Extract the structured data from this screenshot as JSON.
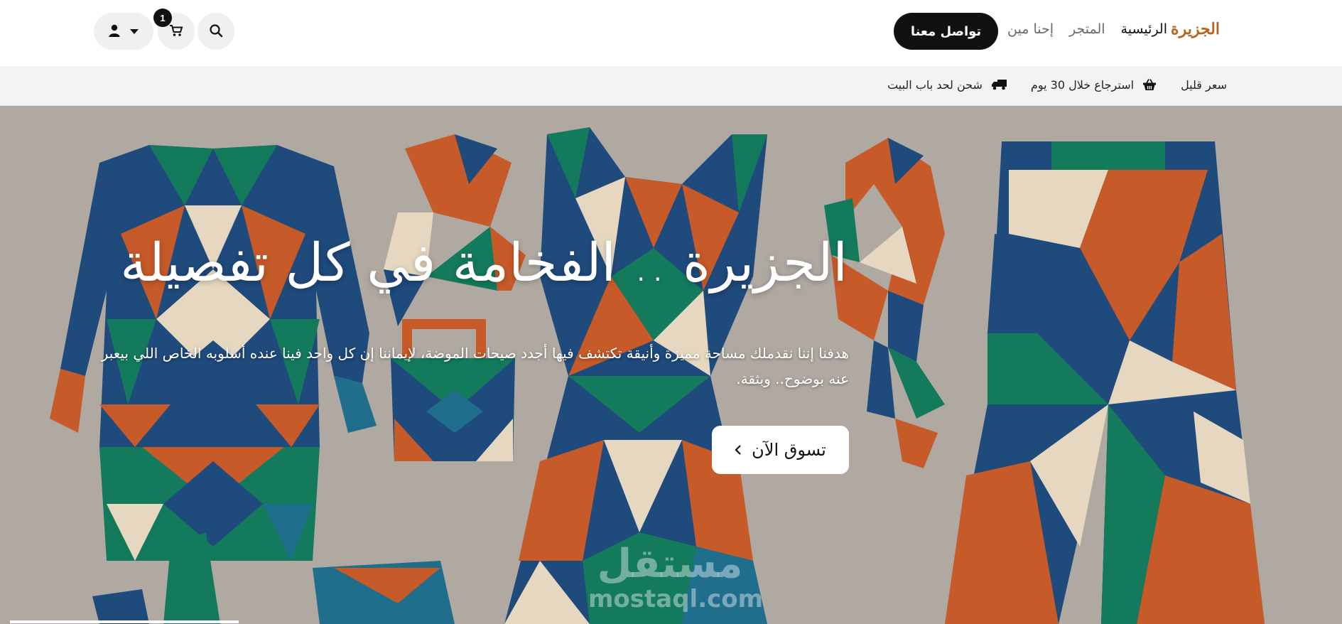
{
  "header": {
    "logo_text": "الجزيرة",
    "nav": [
      {
        "label": "الرئيسية",
        "active": true
      },
      {
        "label": "المتجر",
        "active": false
      },
      {
        "label": "إحنا مين",
        "active": false
      }
    ],
    "contact_label": "تواصل معنا",
    "cart_count": "1",
    "icons": {
      "search": "search-icon",
      "cart": "cart-icon",
      "account": "user-icon",
      "dropdown": "caret-down-icon"
    }
  },
  "features": [
    {
      "icon": "dollar-icon",
      "label": "سعر قليل"
    },
    {
      "icon": "basket-icon",
      "label": "استرجاع خلال 30 يوم"
    },
    {
      "icon": "truck-icon",
      "label": "شحن لحد باب البيت"
    }
  ],
  "hero": {
    "title": "الجزيرة .. الفخامة في كل تفصيلة",
    "description": "هدفنا إننا نقدملك مساحة مميزة وأنيقة تكتشف فيها أجدد صيحات الموضة، لإيماننا إن كل واحد فينا عنده أسلوبه الخاص اللي بيعبر عنه بوضوح.. وبثقة.",
    "cta_label": "تسوق الآن",
    "watermark_arabic": "مستقل",
    "watermark_latin": "mostaql.com"
  },
  "colors": {
    "brand": "#b5651d",
    "dark": "#111111",
    "feature_bar_bg": "#f2f3f5",
    "tile_blue": "#1f4a7c",
    "tile_green": "#147a5c",
    "tile_orange": "#c65a28",
    "tile_cream": "#e6d8c0"
  }
}
